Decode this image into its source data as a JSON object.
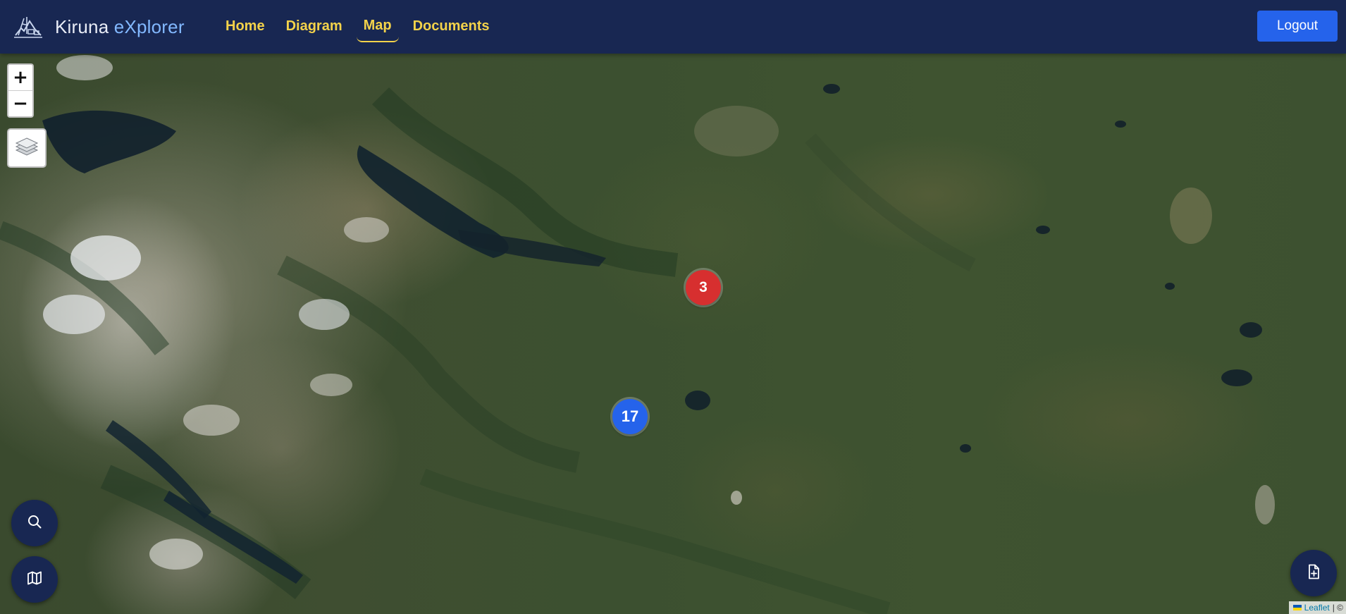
{
  "header": {
    "brand_name": "Kiruna",
    "brand_accent": "eXplorer",
    "logo_icon": "kiruna-logo-icon",
    "nav": [
      {
        "label": "Home",
        "active": false
      },
      {
        "label": "Diagram",
        "active": false
      },
      {
        "label": "Map",
        "active": true
      },
      {
        "label": "Documents",
        "active": false
      }
    ],
    "logout_label": "Logout"
  },
  "map": {
    "zoom_in_label": "+",
    "zoom_out_label": "−",
    "layers_icon": "layers-icon",
    "clusters": [
      {
        "count": "3",
        "color": "#d72f2f"
      },
      {
        "count": "17",
        "color": "#2563eb"
      }
    ],
    "attribution": {
      "link": "Leaflet",
      "separator": "| ©"
    }
  },
  "fabs": {
    "search_icon": "search-icon",
    "map_icon": "map-icon",
    "add_document_icon": "add-document-icon"
  },
  "colors": {
    "header_bg": "#182752",
    "nav_text": "#f3d24a",
    "brand_accent": "#82b8ff",
    "logout_bg": "#2563eb"
  }
}
